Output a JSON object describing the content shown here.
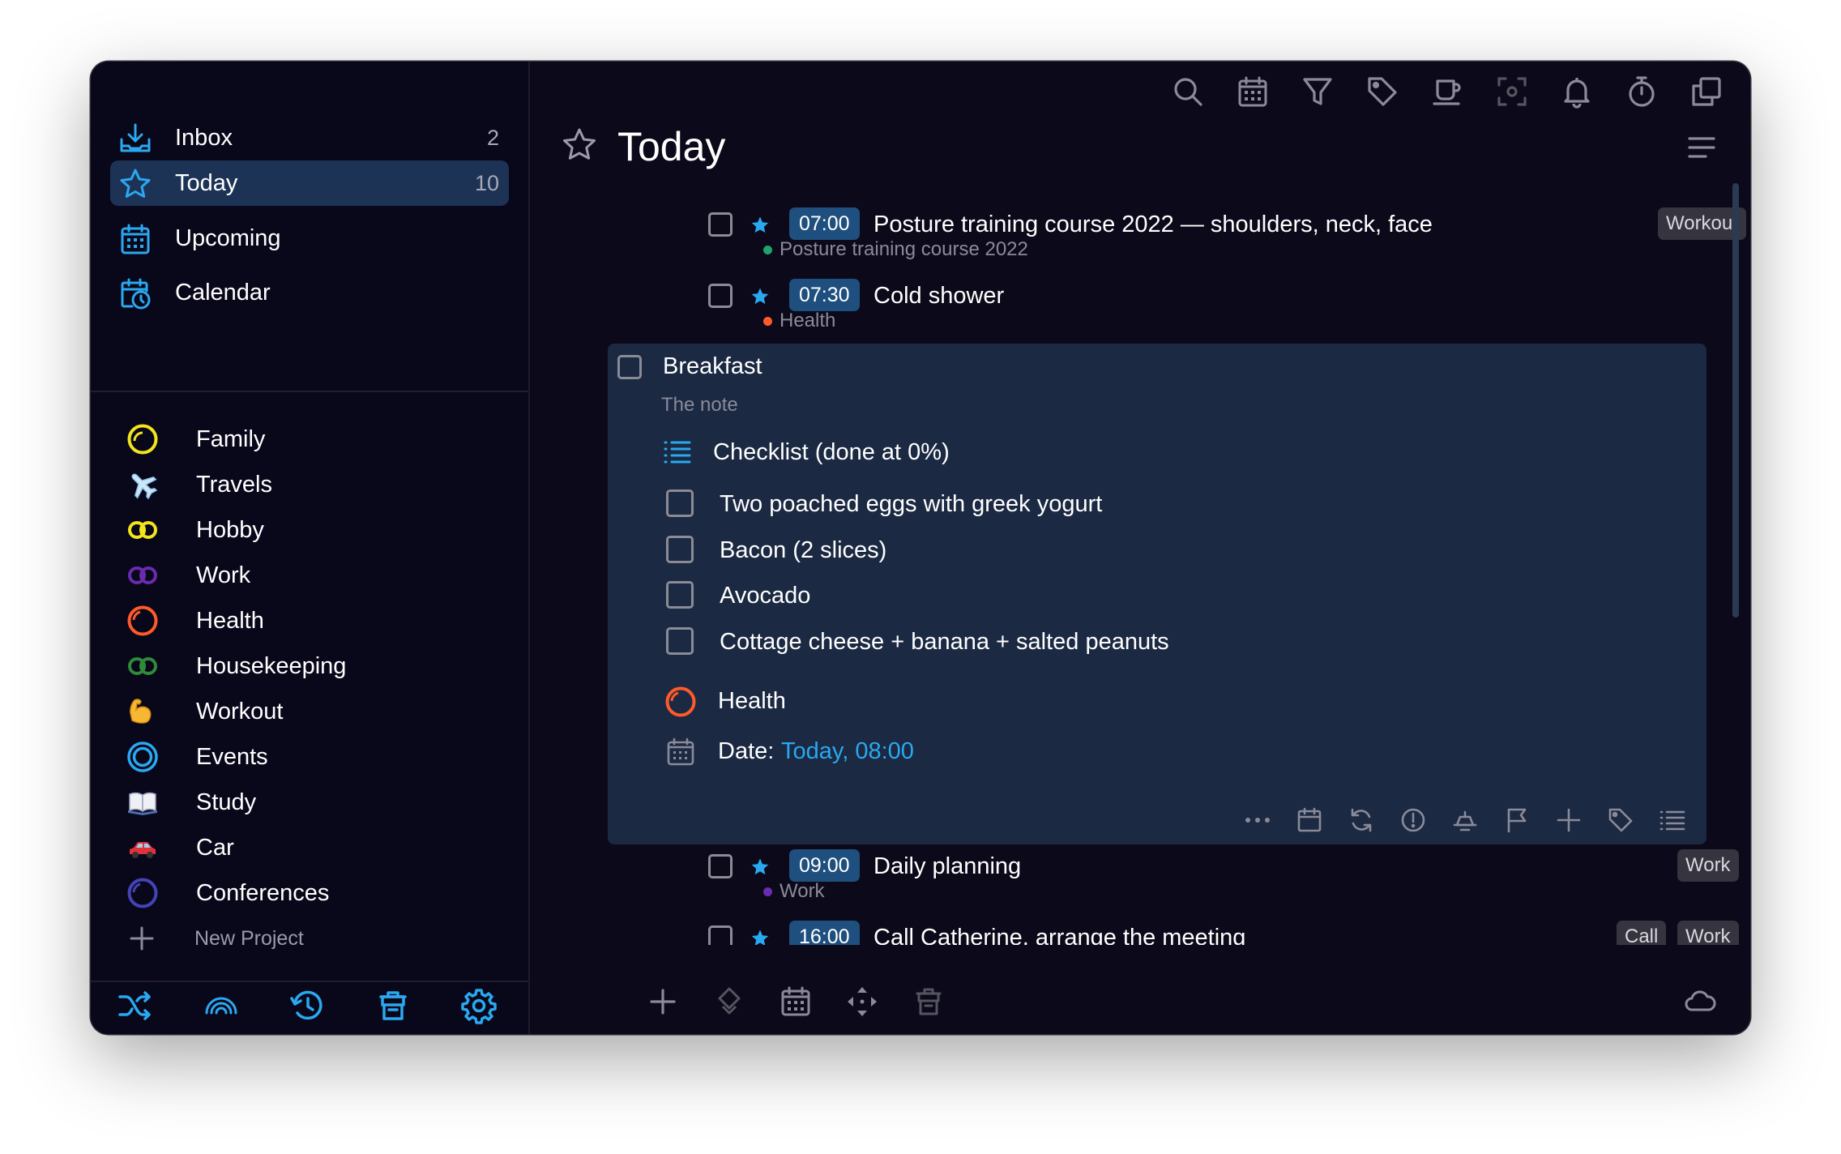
{
  "sidebar": {
    "nav": [
      {
        "label": "Inbox",
        "count": "2",
        "icon": "inbox-icon"
      },
      {
        "label": "Today",
        "count": "10",
        "icon": "star-icon",
        "active": true
      },
      {
        "label": "Upcoming",
        "count": "",
        "icon": "calendar-grid-icon"
      },
      {
        "label": "Calendar",
        "count": "",
        "icon": "calendar-clock-icon"
      }
    ],
    "projects": [
      {
        "label": "Family",
        "icon": "yellow-ring-icon",
        "color": "#f2e51c"
      },
      {
        "label": "Travels",
        "icon": "airplane-icon",
        "color": "#8cc3ec"
      },
      {
        "label": "Hobby",
        "icon": "yellow-double-ring-icon",
        "color": "#f2e51c"
      },
      {
        "label": "Work",
        "icon": "purple-double-ring-icon",
        "color": "#6a2bb0"
      },
      {
        "label": "Health",
        "icon": "orange-ring-icon",
        "color": "#ff5a2a"
      },
      {
        "label": "Housekeeping",
        "icon": "green-double-ring-icon",
        "color": "#2f8a3a"
      },
      {
        "label": "Workout",
        "icon": "flexed-biceps-icon",
        "color": "#f7b733"
      },
      {
        "label": "Events",
        "icon": "blue-double-circle-icon",
        "color": "#2aa8f0"
      },
      {
        "label": "Study",
        "icon": "open-book-icon",
        "color": "#cfd3e0"
      },
      {
        "label": "Car",
        "icon": "red-car-icon",
        "color": "#e0323a"
      },
      {
        "label": "Conferences",
        "icon": "indigo-ring-icon",
        "color": "#4443b8"
      }
    ],
    "new_project": "New Project",
    "bottom_icons": [
      "shuffle-icon",
      "rainbow-icon",
      "history-icon",
      "trash-icon",
      "settings-icon"
    ]
  },
  "toolbar": {
    "icons": [
      "search-icon",
      "calendar-icon",
      "filter-icon",
      "tag-icon",
      "coffee-icon",
      "focus-icon",
      "bell-icon",
      "timer-icon",
      "copy-icon"
    ]
  },
  "header": {
    "title": "Today"
  },
  "tasks": [
    {
      "time": "07:00",
      "title": "Posture training course 2022 — shoulders, neck, face",
      "project": "Posture training course 2022",
      "project_color": "#1fa36f",
      "tags": [
        "Workout"
      ]
    },
    {
      "time": "07:30",
      "title": "Cold shower",
      "project": "Health",
      "project_color": "#ff5a2a",
      "tags": []
    },
    {
      "time": "",
      "title": "Breakfast",
      "project": "",
      "tags": []
    },
    {
      "time": "09:00",
      "title": "Daily planning",
      "project": "Work",
      "project_color": "#6a2bb0",
      "tags": [
        "Work"
      ]
    },
    {
      "time": "16:00",
      "title": "Call Catherine, arrange the meeting",
      "project": "",
      "tags": [
        "Call",
        "Work"
      ]
    }
  ],
  "expanded": {
    "note": "The note",
    "checklist_title": "Checklist (done at 0%)",
    "checklist": [
      "Two poached eggs with greek yogurt",
      "Bacon (2 slices)",
      "Avocado",
      "Cottage cheese + banana + salted peanuts"
    ],
    "project": "Health",
    "date_label": "Date:",
    "date_value": "Today, 08:00",
    "actions": [
      "more-icon",
      "calendar-icon",
      "repeat-icon",
      "priority-icon",
      "reminder-icon",
      "flag-icon",
      "move-icon",
      "tag-icon",
      "checklist-icon"
    ]
  },
  "main_bottom_icons": [
    "add-icon",
    "diamond-icon",
    "calendar-icon",
    "move-arrows-icon",
    "trash-icon",
    "cloud-icon"
  ],
  "colors": {
    "accent": "#2aa8f0",
    "background": "#0c0a1a",
    "selection": "#1d3355",
    "expanded": "#1b2942"
  }
}
